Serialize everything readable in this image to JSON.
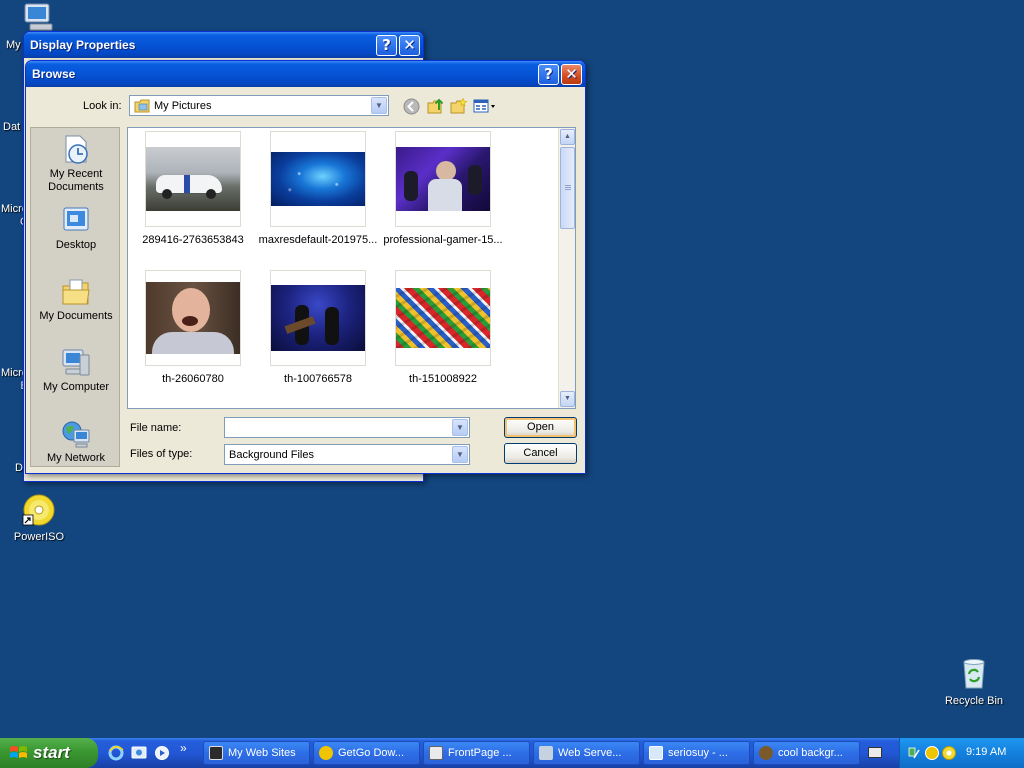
{
  "desktop": {
    "icons_partial": [
      {
        "label": "My"
      },
      {
        "label": "Dat"
      },
      {
        "label": "Micro\nC"
      },
      {
        "label": "Micro\nB"
      },
      {
        "label": "D"
      }
    ],
    "poweriso_label": "PowerISO",
    "recycle_label": "Recycle Bin"
  },
  "display_properties": {
    "title": "Display Properties",
    "help_glyph": "?",
    "close_glyph": "✕"
  },
  "browse": {
    "title": "Browse",
    "help_glyph": "?",
    "close_glyph": "✕",
    "look_in_label": "Look in:",
    "look_in_value": "My Pictures",
    "places": [
      {
        "label": "My Recent Documents",
        "icon": "recent-documents-icon"
      },
      {
        "label": "Desktop",
        "icon": "desktop-icon"
      },
      {
        "label": "My Documents",
        "icon": "my-documents-icon"
      },
      {
        "label": "My Computer",
        "icon": "my-computer-icon"
      },
      {
        "label": "My Network",
        "icon": "my-network-icon"
      }
    ],
    "files": [
      {
        "name": "289416-2763653843"
      },
      {
        "name": "maxresdefault-201975..."
      },
      {
        "name": "professional-gamer-15..."
      },
      {
        "name": "th-26060780"
      },
      {
        "name": "th-100766578"
      },
      {
        "name": "th-151008922"
      }
    ],
    "file_name_label": "File name:",
    "file_name_value": "",
    "files_of_type_label": "Files of type:",
    "files_of_type_value": "Background Files",
    "open_label": "Open",
    "cancel_label": "Cancel"
  },
  "taskbar": {
    "start_label": "start",
    "overflow_glyph": "»",
    "tasks": [
      {
        "label": "My Web Sites"
      },
      {
        "label": "GetGo Dow..."
      },
      {
        "label": "FrontPage ..."
      },
      {
        "label": "Web Serve..."
      },
      {
        "label": "seriosuy - ..."
      },
      {
        "label": "cool backgr..."
      }
    ],
    "clock": "9:19 AM"
  }
}
